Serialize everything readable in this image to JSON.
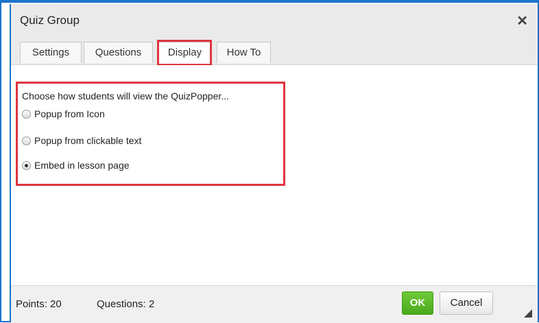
{
  "dialog": {
    "title": "Quiz Group",
    "close_icon": "close-icon"
  },
  "tabs": [
    {
      "label": "Settings"
    },
    {
      "label": "Questions"
    },
    {
      "label": "Display",
      "active": true
    },
    {
      "label": "How To"
    }
  ],
  "display": {
    "prompt": "Choose how students will view the QuizPopper...",
    "options": [
      {
        "label": "Popup from Icon",
        "checked": false
      },
      {
        "label": "Popup from clickable text",
        "checked": false
      },
      {
        "label": "Embed in lesson page",
        "checked": true
      }
    ]
  },
  "footer": {
    "points": "Points: 20",
    "questions": "Questions: 2",
    "ok_label": "OK",
    "cancel_label": "Cancel"
  },
  "colors": {
    "accent": "#1a74c9",
    "highlight": "#e0343f",
    "ok_green": "#4aaa1c"
  }
}
